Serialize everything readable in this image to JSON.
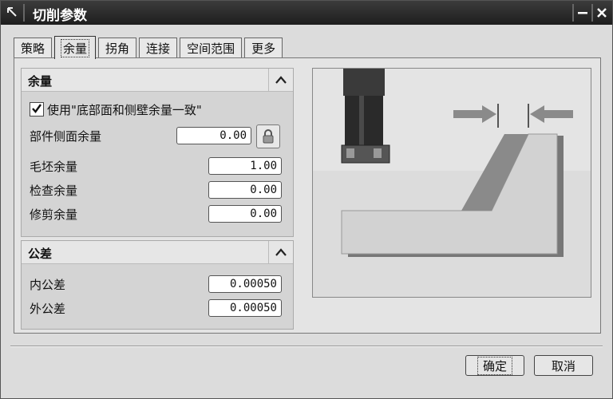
{
  "window": {
    "title": "切削参数"
  },
  "tabs": [
    "策略",
    "余量",
    "拐角",
    "连接",
    "空间范围",
    "更多"
  ],
  "active_tab": "余量",
  "allowance_group": {
    "title": "余量",
    "checkbox_label": "使用\"底部面和侧壁余量一致\"",
    "checkbox_checked": true,
    "part_side_label": "部件侧面余量",
    "part_side_value": "0.00",
    "blank_label": "毛坯余量",
    "blank_value": "1.00",
    "check_label": "检查余量",
    "check_value": "0.00",
    "trim_label": "修剪余量",
    "trim_value": "0.00"
  },
  "tolerance_group": {
    "title": "公差",
    "intol_label": "内公差",
    "intol_value": "0.00050",
    "outtol_label": "外公差",
    "outtol_value": "0.00050"
  },
  "buttons": {
    "ok": "确定",
    "cancel": "取消"
  },
  "icons": {
    "app": "nx-arrow-icon",
    "minimize": "minimize-icon",
    "close": "close-icon",
    "collapse": "chevron-up-icon",
    "lock": "lock-icon"
  }
}
